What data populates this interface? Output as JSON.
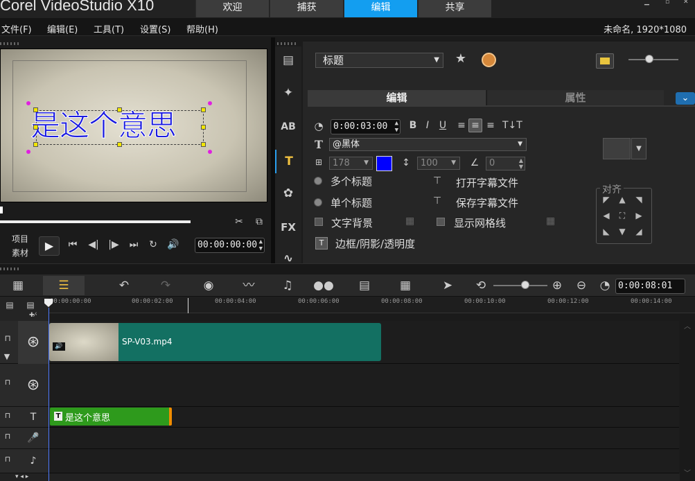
{
  "app": {
    "brand": "Corel VideoStudio X10",
    "tabs": [
      {
        "label": "欢迎"
      },
      {
        "label": "捕获"
      },
      {
        "label": "编辑",
        "active": true
      },
      {
        "label": "共享"
      }
    ]
  },
  "menu": {
    "items": [
      "文件(F)",
      "编辑(E)",
      "工具(T)",
      "设置(S)",
      "帮助(H)"
    ],
    "project_info": "未命名, 1920*1080"
  },
  "preview": {
    "title_text": "是这个意思",
    "mode_project": "项目",
    "mode_clip": "素材",
    "timecode": "00:00:00:00"
  },
  "options": {
    "category": "标题",
    "subtabs": [
      "编辑",
      "属性"
    ],
    "duration": "0:00:03:00",
    "bold": "B",
    "italic": "I",
    "underline": "U",
    "font": "@黑体",
    "font_size": "178",
    "line_spacing": "100",
    "rotation": "0",
    "multi_title": "多个标题",
    "single_title": "单个标题",
    "open_subtitle": "打开字幕文件",
    "save_subtitle": "保存字幕文件",
    "text_background": "文字背景",
    "show_grid": "显示网格线",
    "border_shadow": "边框/阴影/透明度",
    "align_label": "对齐",
    "text_color": "#0000ff"
  },
  "timeline": {
    "ruler": [
      "00:00:00:00",
      "00:00:02:00",
      "00:00:04:00",
      "00:00:06:00",
      "00:00:08:00",
      "00:00:10:00",
      "00:00:12:00",
      "00:00:14:00"
    ],
    "duration": "0:00:08:01",
    "video_clip": "SP-V03.mp4",
    "title_clip": "是这个意思",
    "title_clip_icon": "T"
  },
  "colors": {
    "accent": "#139ef0",
    "video_clip": "#137062",
    "title_clip": "#2e9a1c",
    "clip_edge": "#f08c00"
  }
}
